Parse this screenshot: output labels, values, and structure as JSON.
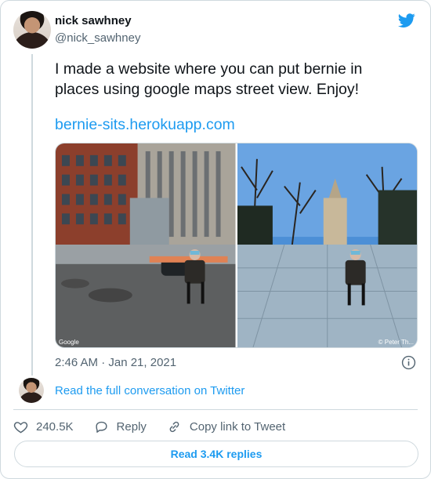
{
  "author": {
    "name": "nick sawhney",
    "handle": "@nick_sawhney"
  },
  "tweet": {
    "text": "I made a website where you can put bernie in places using google maps street view. Enjoy!",
    "link": "bernie-sits.herokuapp.com",
    "timestamp": "2:46 AM · Jan 21, 2021"
  },
  "photos": [
    {
      "caption": "Google"
    },
    {
      "caption": "© Peter Th..."
    }
  ],
  "conversation_link": "Read the full conversation on Twitter",
  "actions": {
    "likes": "240.5K",
    "reply_label": "Reply",
    "copy_label": "Copy link to Tweet"
  },
  "replies_button": "Read 3.4K replies",
  "colors": {
    "accent": "#1d9bf0",
    "secondary_text": "#536471",
    "border": "#cfd9de"
  },
  "icons": [
    "twitter-bird-icon",
    "info-icon",
    "heart-icon",
    "reply-icon",
    "link-icon"
  ]
}
